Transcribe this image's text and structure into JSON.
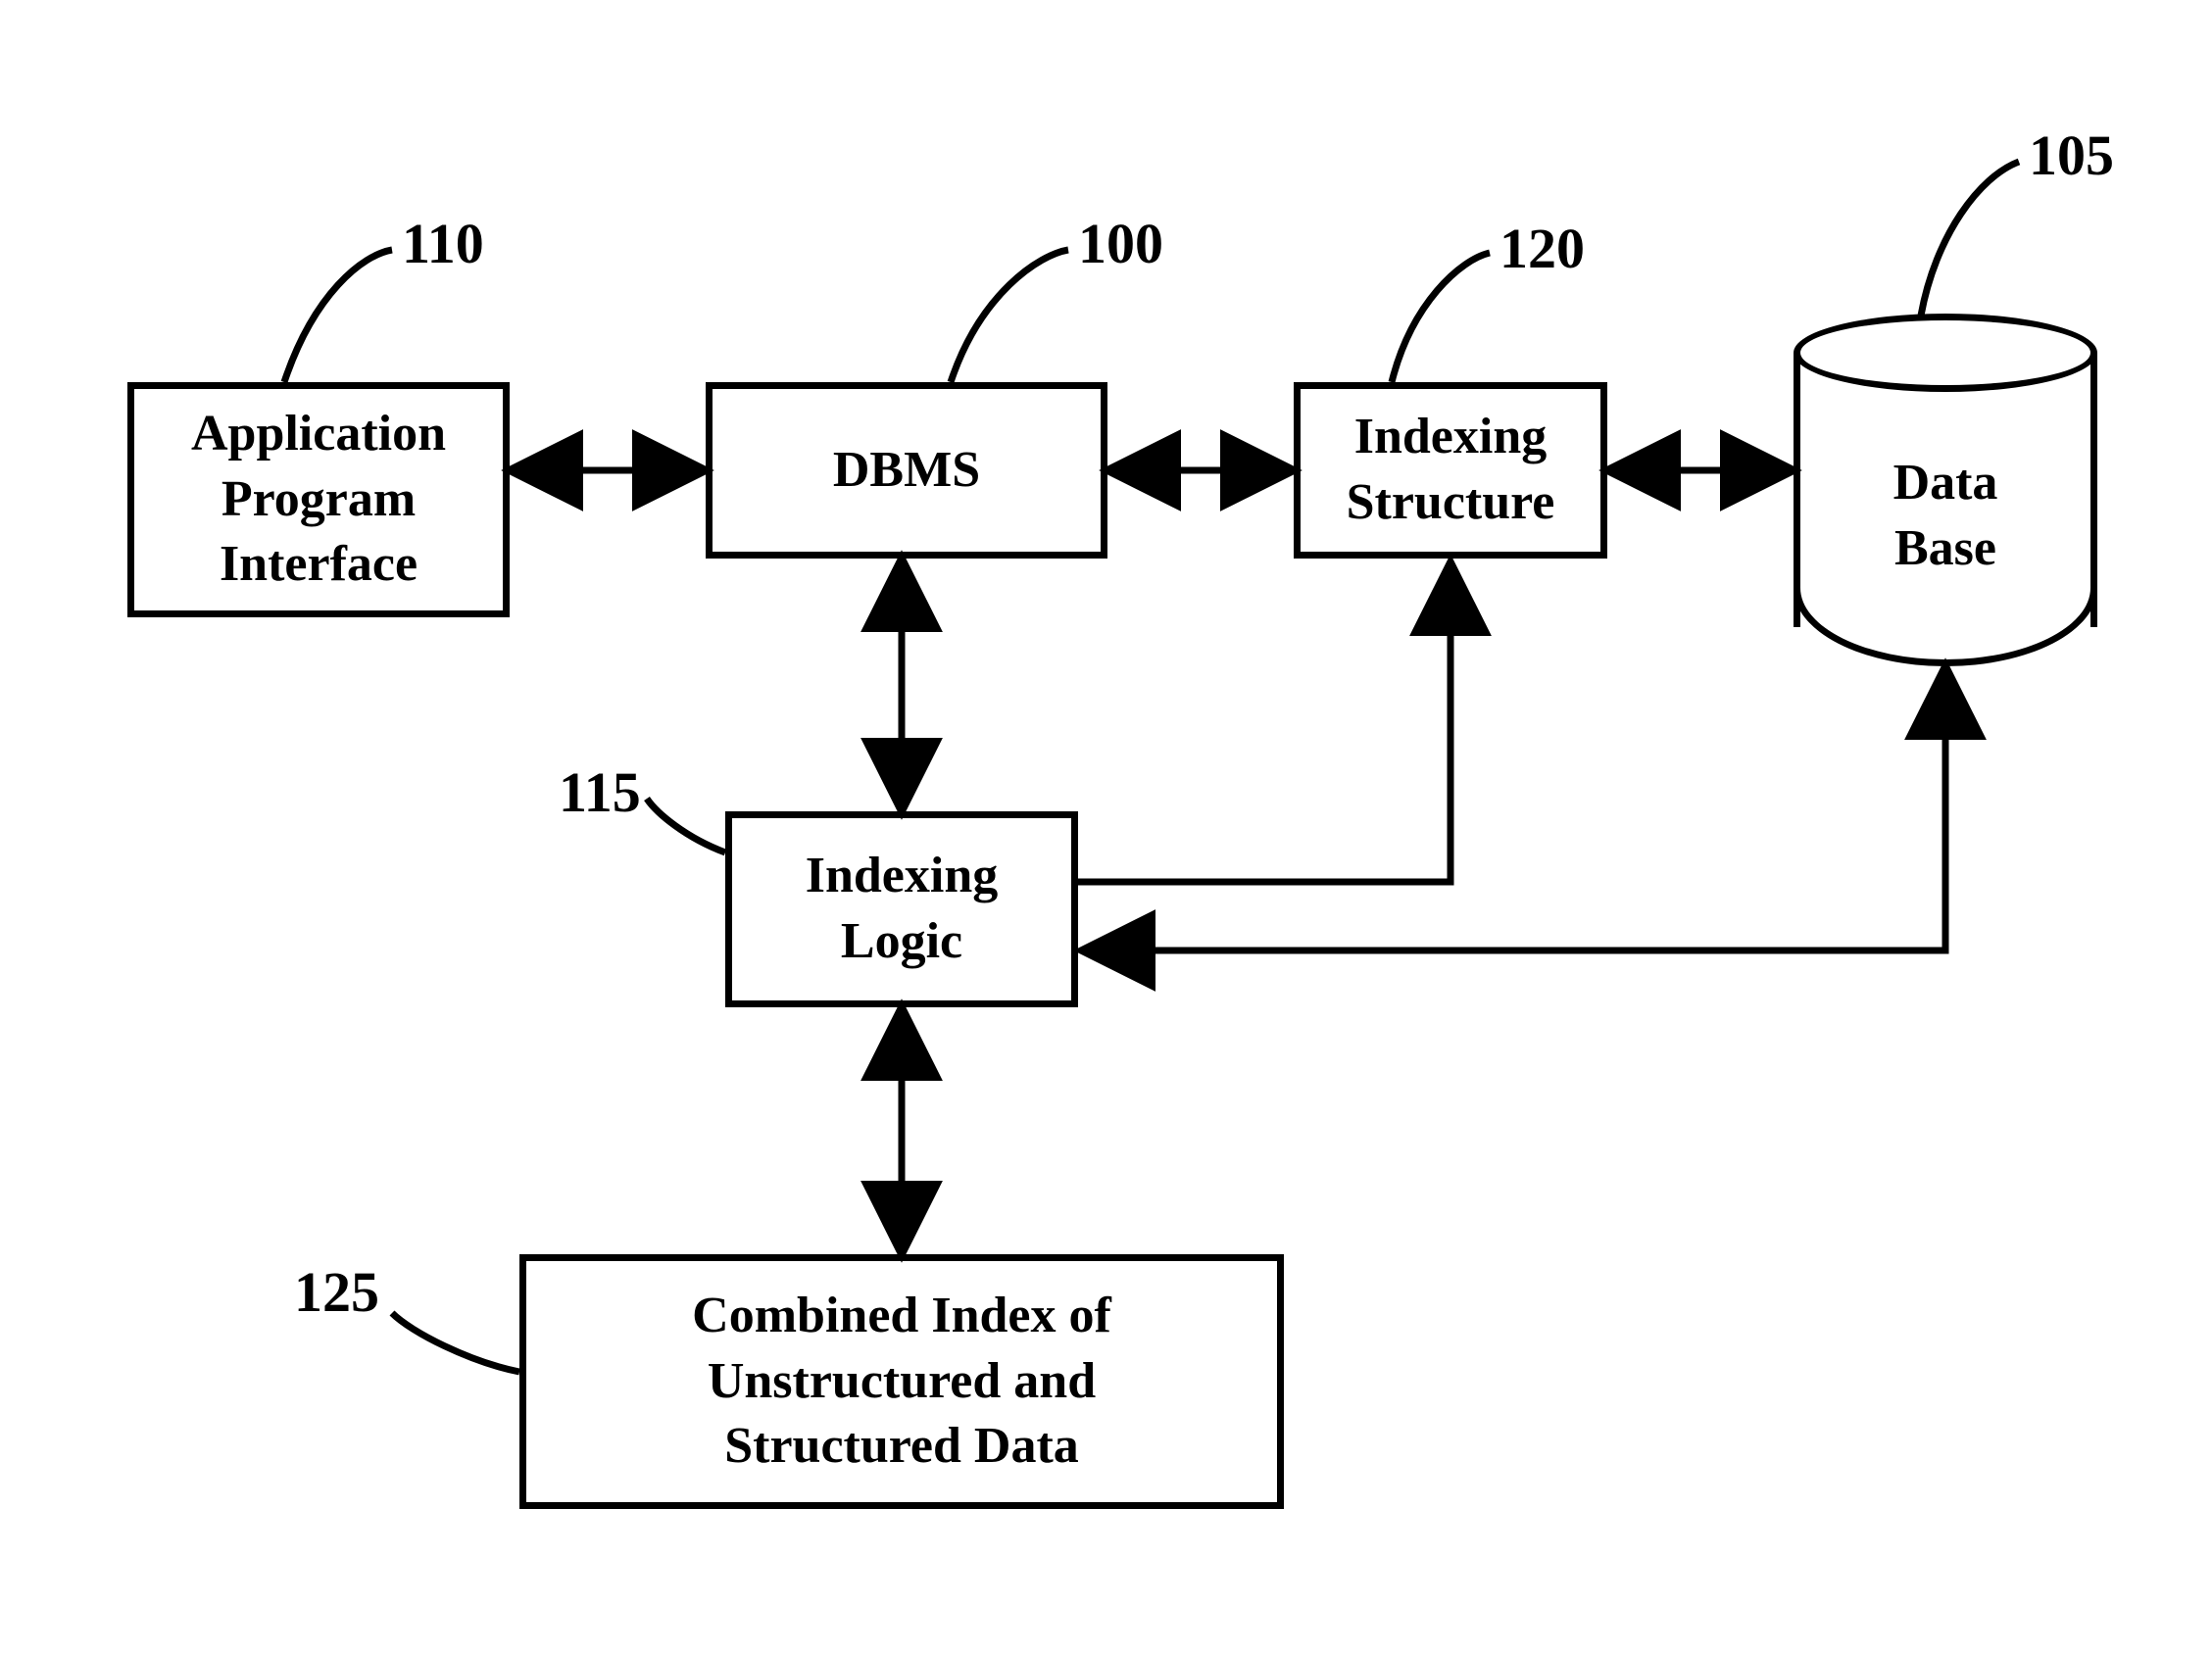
{
  "nodes": {
    "api": {
      "ref": "110",
      "label": "Application\nProgram\nInterface"
    },
    "dbms": {
      "ref": "100",
      "label": "DBMS"
    },
    "indexing_structure": {
      "ref": "120",
      "label": "Indexing\nStructure"
    },
    "database": {
      "ref": "105",
      "label": "Data\nBase"
    },
    "indexing_logic": {
      "ref": "115",
      "label": "Indexing\nLogic"
    },
    "combined_index": {
      "ref": "125",
      "label": "Combined Index of\nUnstructured and\nStructured Data"
    }
  },
  "edges": [
    {
      "from": "api",
      "to": "dbms",
      "bidirectional": true
    },
    {
      "from": "dbms",
      "to": "indexing_structure",
      "bidirectional": true
    },
    {
      "from": "indexing_structure",
      "to": "database",
      "bidirectional": true
    },
    {
      "from": "dbms",
      "to": "indexing_logic",
      "bidirectional": true
    },
    {
      "from": "indexing_logic",
      "to": "indexing_structure",
      "bidirectional": false
    },
    {
      "from": "database",
      "to": "indexing_logic",
      "bidirectional": false
    },
    {
      "from": "indexing_logic",
      "to": "combined_index",
      "bidirectional": true
    }
  ]
}
